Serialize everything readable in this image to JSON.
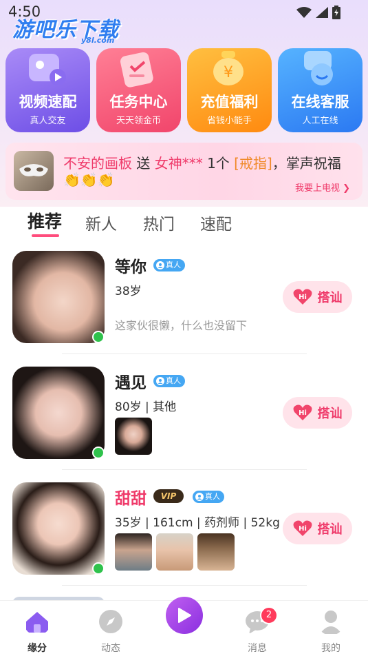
{
  "status_bar": {
    "time": "4:50"
  },
  "watermark": {
    "brand": "游吧乐下载",
    "domain": "y8l.com"
  },
  "features": [
    {
      "title": "视频速配",
      "subtitle": "真人交友",
      "icon": "video-camera-icon"
    },
    {
      "title": "任务中心",
      "subtitle": "天天领金币",
      "icon": "task-ticket-icon"
    },
    {
      "title": "充值福利",
      "subtitle": "省钱小能手",
      "icon": "money-bag-icon"
    },
    {
      "title": "在线客服",
      "subtitle": "人工在线",
      "icon": "headset-icon"
    }
  ],
  "broadcast": {
    "sender": "不安的画板",
    "verb": " 送 ",
    "receiver": "女神***",
    "count": " 1个 ",
    "gift": "[戒指]",
    "tail": "，掌声祝福",
    "claps": "👏👏👏",
    "tv_link": "我要上电视"
  },
  "tabs": [
    "推荐",
    "新人",
    "热门",
    "速配"
  ],
  "users": [
    {
      "name": "等你",
      "real_badge": "真人",
      "vip": false,
      "info": "38岁",
      "bio": "这家伙很懒，什么也没留下",
      "online": true,
      "photos": 0
    },
    {
      "name": "遇见",
      "real_badge": "真人",
      "vip": false,
      "info": "80岁 | 其他",
      "bio": "",
      "online": true,
      "photos": 1
    },
    {
      "name": "甜甜",
      "real_badge": "真人",
      "vip": true,
      "vip_label": "VIP",
      "info": "35岁 | 161cm | 药剂师 | 52kg",
      "bio": "",
      "online": true,
      "photos": 3
    }
  ],
  "greet_button": {
    "label": "搭讪",
    "icon_text": "Hi"
  },
  "bottom_nav": [
    {
      "label": "缘分",
      "icon": "home-icon",
      "active": true
    },
    {
      "label": "动态",
      "icon": "compass-icon",
      "active": false
    },
    {
      "label": "",
      "icon": "play-icon",
      "active": false
    },
    {
      "label": "消息",
      "icon": "chat-bubble-icon",
      "active": false,
      "badge": "2"
    },
    {
      "label": "我的",
      "icon": "profile-icon",
      "active": false
    }
  ],
  "colors": {
    "accent_pink": "#ef3a6a",
    "online_green": "#2fc24c",
    "real_badge_blue": "#45a7f3",
    "nav_purple": "#8b2fe0"
  }
}
